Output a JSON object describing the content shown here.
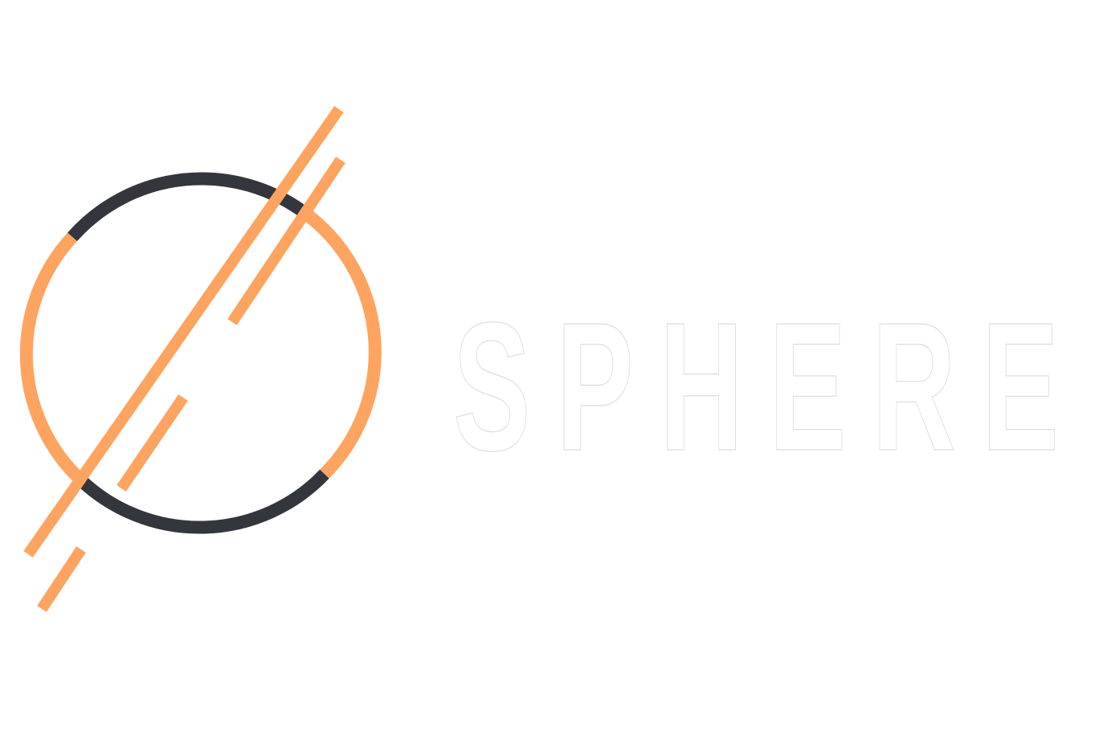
{
  "logo": {
    "wordmark": "SPHERE",
    "colors": {
      "accent": "#FFA360",
      "ring_dark": "#33363C",
      "wordmark_fill": "#FFFFFF",
      "wordmark_outline": "#D9DBE0"
    }
  }
}
